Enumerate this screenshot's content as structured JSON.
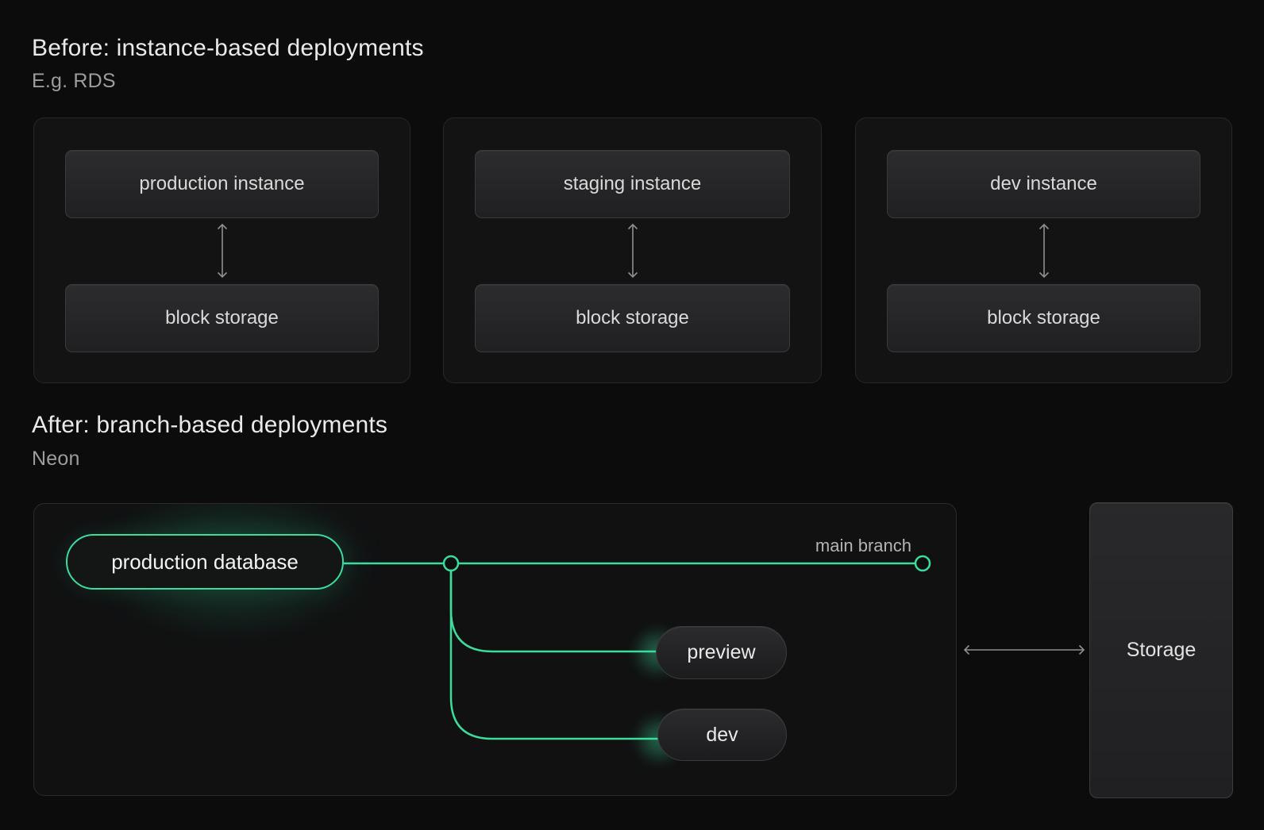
{
  "colors": {
    "background": "#0C0C0D",
    "card_background": "#131314",
    "accent_green": "#3CDC9D",
    "heading_text": "#EAEAEA",
    "subtitle_text": "#9D9D9D",
    "arrow_gray": "#8F8F8F"
  },
  "sections": {
    "before": {
      "title": "Before: instance-based deployments",
      "subtitle": "E.g. RDS",
      "cards": [
        {
          "instance_label": "production instance",
          "storage_label": "block storage"
        },
        {
          "instance_label": "staging instance",
          "storage_label": "block storage"
        },
        {
          "instance_label": "dev instance",
          "storage_label": "block storage"
        }
      ]
    },
    "after": {
      "title": "After: branch-based deployments",
      "subtitle": "Neon",
      "diagram": {
        "production_label": "production database",
        "main_branch_label": "main branch",
        "branches": [
          {
            "label": "preview"
          },
          {
            "label": "dev"
          }
        ],
        "storage_label": "Storage"
      }
    }
  }
}
